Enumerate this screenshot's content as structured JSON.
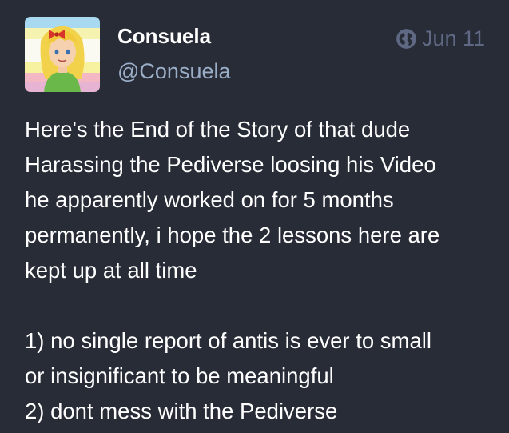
{
  "post": {
    "display_name": "Consuela",
    "handle": "@Consuela",
    "visibility_icon": "globe-icon",
    "date": "Jun 11",
    "paragraphs": [
      {
        "lines": [
          "Here's the End of the Story of that dude",
          "Harassing the Pediverse loosing his Video",
          "he apparently worked on for 5 months",
          "permanently, i hope the 2 lessons here are",
          "kept up at all time"
        ]
      },
      {
        "lines": [
          "1) no single report of antis is ever to small",
          "or insignificant to be meaningful",
          "2) dont mess with the Pediverse"
        ]
      }
    ]
  },
  "colors": {
    "background": "#282c37",
    "name": "#ffffff",
    "handle": "#9baec8",
    "timestamp": "#606984",
    "text": "#ffffff"
  }
}
